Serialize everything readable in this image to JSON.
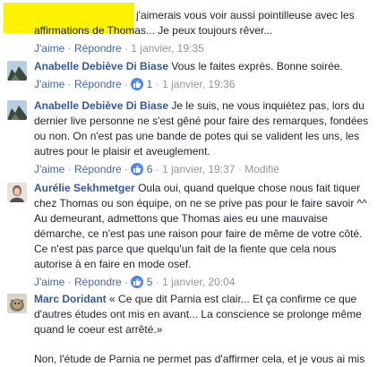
{
  "comments": [
    {
      "text_line1": "j'aimerais vous voir aussi pointilleuse avec les",
      "text_rest": "affirmations de Thomas... Je peux toujours rêver...",
      "like": "J'aime",
      "reply": "Répondre",
      "time": "1 janvier, 19:35"
    },
    {
      "author": "Anabelle Debiève Di Biase",
      "text": "Vous le faites exprès. Bonne soirée.",
      "like": "J'aime",
      "reply": "Répondre",
      "reactions": "1",
      "time": "1 janvier, 19:36"
    },
    {
      "author": "Anabelle Debiève Di Biase",
      "text": "Je le suis, ne vous inquiétez pas, lors du dernier live personne ne s'est gêné pour faire des remarques, fondées ou non. On n'est pas une bande de potes qui se valident les uns, les autres pour le plaisir et aveuglement.",
      "like": "J'aime",
      "reply": "Répondre",
      "reactions": "6",
      "time": "1 janvier, 19:37",
      "edited": "Modifié"
    },
    {
      "author": "Aurélie Sekhmetger",
      "text": "Oula oui, quand quelque chose nous fait tiquer chez Thomas ou son équipe, on ne se prive pas pour le faire savoir ^^ Au demeurant, admettons que Thomas aies eu une mauvaise démarche, ce n'est pas une raison pour faire de même de votre côté. Ce n'est pas parce que quelqu'un fait de la fiente que cela nous autorise à en faire en mode osef.",
      "like": "J'aime",
      "reply": "Répondre",
      "reactions": "5",
      "time": "1 janvier, 20:04"
    },
    {
      "author": "Marc Doridant",
      "text": "« Ce que dit Parnia est clair... Et ça confirme ce que d'autres études ont mis en avant... La conscience se prolonge même quand le coeur est arrêté.»",
      "text_rest": "Non, l'étude de Parnia ne permet pas d'affirmer cela, et je vous ai mis"
    }
  ],
  "sep": "·",
  "colors": {
    "link": "#365899",
    "meta": "#90949c",
    "like_badge": "#4e87f2",
    "highlight": "#fdf200"
  }
}
